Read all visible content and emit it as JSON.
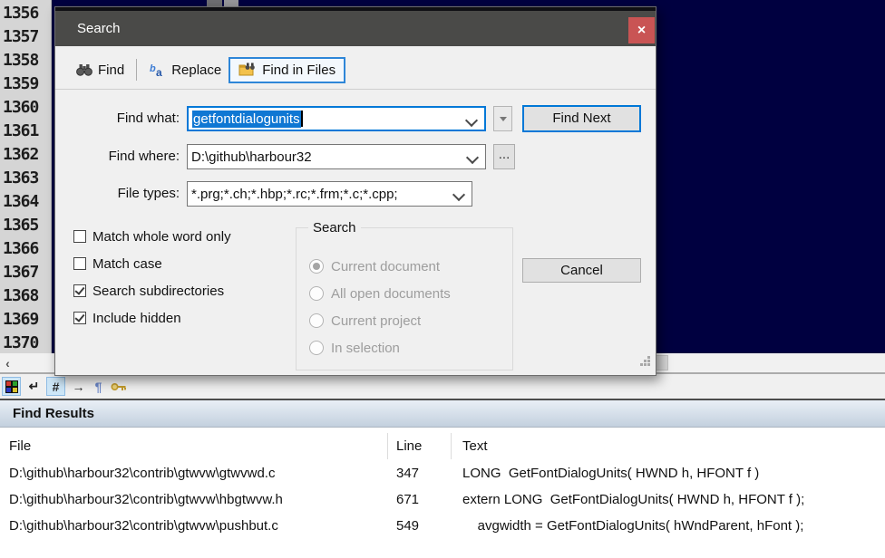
{
  "colors": {
    "editor_bg": "#000040",
    "title_bar": "#4a4a48",
    "close_red": "#c95454",
    "accent_blue": "#0078d7",
    "selection_blue": "#0f77d3",
    "results_caption_gradient": [
      "#e9eff6",
      "#c3d0de"
    ]
  },
  "editor": {
    "line_numbers": [
      "1356",
      "1357",
      "1358",
      "1359",
      "1360",
      "1361",
      "1362",
      "1363",
      "1364",
      "1365",
      "1366",
      "1367",
      "1368",
      "1369",
      "1370"
    ]
  },
  "editor_scrollbar": {
    "left_glyph": "‹"
  },
  "editor_toolbar": {
    "icons": [
      {
        "name": "color-blocks-icon",
        "active": true
      },
      {
        "name": "line-break-icon",
        "glyph": "↵",
        "active": false
      },
      {
        "name": "line-numbers-icon",
        "glyph": "#",
        "active": true
      },
      {
        "name": "tab-arrow-icon",
        "glyph": "→",
        "active": false
      },
      {
        "name": "pilcrow-icon",
        "glyph": "¶",
        "active": false
      },
      {
        "name": "macro-key-icon",
        "active": false
      }
    ]
  },
  "dialog": {
    "title": "Search",
    "close_glyph": "×",
    "tabs": [
      {
        "label": "Find",
        "icon": "binoculars-icon",
        "active": false
      },
      {
        "label": "Replace",
        "icon": "replace-letters-icon",
        "active": false
      },
      {
        "label": "Find in Files",
        "icon": "folder-search-icon",
        "active": true
      }
    ],
    "fields": {
      "find_what": {
        "label": "Find what:",
        "value": "getfontdialogunits"
      },
      "find_where": {
        "label": "Find where:",
        "value": "D:\\github\\harbour32"
      },
      "file_types": {
        "label": "File types:",
        "value": "*.prg;*.ch;*.hbp;*.rc;*.frm;*.c;*.cpp;"
      }
    },
    "buttons": {
      "find_next": "Find Next",
      "cancel": "Cancel",
      "browse": "..."
    },
    "checkboxes": [
      {
        "label": "Match whole word only",
        "checked": false
      },
      {
        "label": "Match case",
        "checked": false
      },
      {
        "label": "Search subdirectories",
        "checked": true
      },
      {
        "label": "Include hidden",
        "checked": true
      }
    ],
    "search_group": {
      "label": "Search",
      "options": [
        {
          "label": "Current document",
          "selected": true,
          "enabled": false
        },
        {
          "label": "All open documents",
          "selected": false,
          "enabled": false
        },
        {
          "label": "Current project",
          "selected": false,
          "enabled": false
        },
        {
          "label": "In selection",
          "selected": false,
          "enabled": false
        }
      ]
    }
  },
  "results": {
    "title": "Find Results",
    "columns": [
      "File",
      "Line",
      "Text"
    ],
    "rows": [
      {
        "file": "D:\\github\\harbour32\\contrib\\gtwvw\\gtwvwd.c",
        "line": "347",
        "text": "LONG  GetFontDialogUnits( HWND h, HFONT f )"
      },
      {
        "file": "D:\\github\\harbour32\\contrib\\gtwvw\\hbgtwvw.h",
        "line": "671",
        "text": "extern LONG  GetFontDialogUnits( HWND h, HFONT f );"
      },
      {
        "file": "D:\\github\\harbour32\\contrib\\gtwvw\\pushbut.c",
        "line": "549",
        "text": "    avgwidth = GetFontDialogUnits( hWndParent, hFont );"
      }
    ]
  }
}
